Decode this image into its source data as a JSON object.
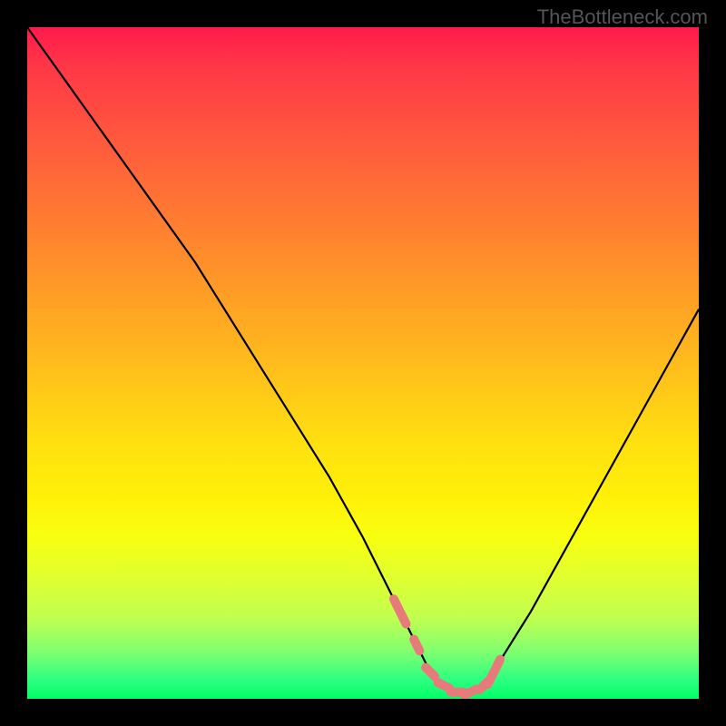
{
  "watermark": "TheBottleneck.com",
  "chart_data": {
    "type": "line",
    "title": "",
    "xlabel": "",
    "ylabel": "",
    "xlim": [
      0,
      100
    ],
    "ylim": [
      0,
      100
    ],
    "x": [
      0,
      5,
      10,
      15,
      20,
      25,
      30,
      35,
      40,
      45,
      50,
      55,
      58,
      60,
      62,
      64,
      66,
      68,
      70,
      75,
      80,
      85,
      90,
      95,
      100
    ],
    "values": [
      100,
      93,
      86,
      79,
      72,
      65,
      57,
      49,
      41,
      33,
      24,
      14,
      8,
      4,
      2,
      1,
      1,
      2,
      5,
      13,
      22,
      31,
      40,
      49,
      58
    ],
    "marker_x": [
      55,
      56,
      58,
      60,
      62,
      64,
      66,
      68,
      69,
      70
    ],
    "marker_y": [
      14,
      12,
      8,
      4,
      2,
      1,
      1,
      2,
      3,
      5
    ],
    "marker_color": "#e77b7b",
    "line_color": "#000000"
  }
}
